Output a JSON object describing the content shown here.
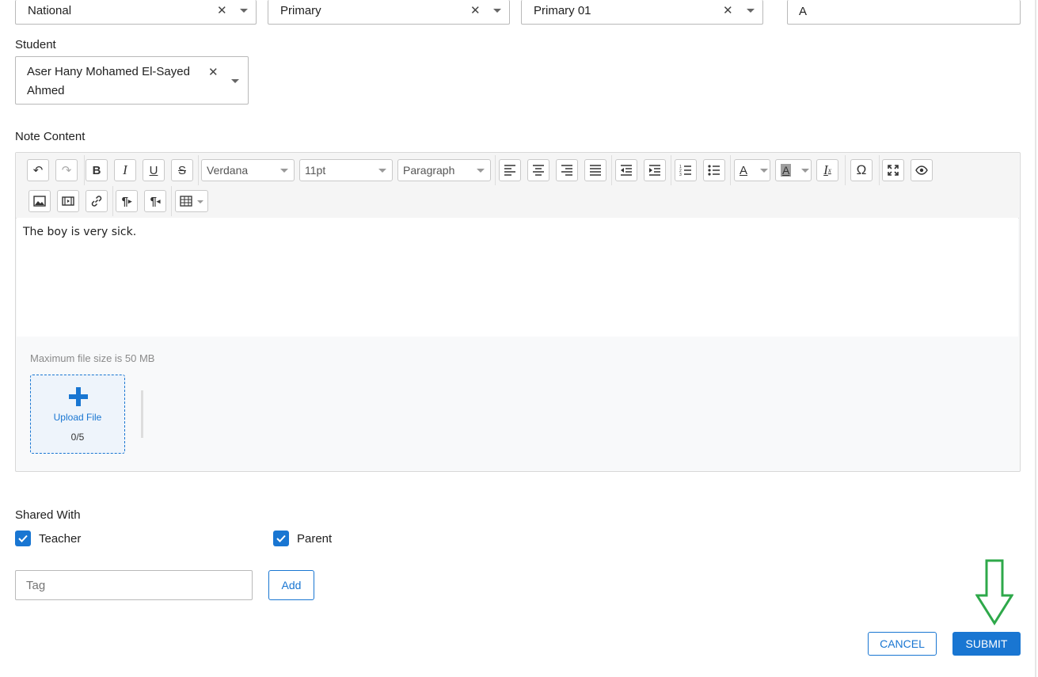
{
  "filters": [
    {
      "value": "National"
    },
    {
      "value": "Primary"
    },
    {
      "value": "Primary 01"
    },
    {
      "value": "A"
    }
  ],
  "student": {
    "label": "Student",
    "line1": "Aser Hany Mohamed El-Sayed",
    "line2": "Ahmed"
  },
  "note": {
    "label": "Note Content",
    "toolbar": {
      "font_family": "Verdana",
      "font_size": "11pt",
      "block_format": "Paragraph"
    },
    "content": "The boy is very sick.",
    "upload": {
      "max_size_text": "Maximum file size is 50 MB",
      "button_label": "Upload File",
      "count": "0/5"
    }
  },
  "shared_with": {
    "label": "Shared With",
    "options": [
      {
        "label": "Teacher",
        "checked": true
      },
      {
        "label": "Parent",
        "checked": true
      }
    ]
  },
  "tag": {
    "placeholder": "Tag",
    "add_label": "Add"
  },
  "actions": {
    "cancel_label": "CANCEL",
    "submit_label": "SUBMIT"
  },
  "colors": {
    "primary": "#1976d2",
    "annotation_arrow": "#2ea84a"
  },
  "icons": [
    "undo-icon",
    "redo-icon",
    "bold-icon",
    "italic-icon",
    "underline-icon",
    "strikethrough-icon",
    "align-left-icon",
    "align-center-icon",
    "align-right-icon",
    "align-justify-icon",
    "outdent-icon",
    "indent-icon",
    "numbered-list-icon",
    "bullet-list-icon",
    "text-color-icon",
    "highlight-color-icon",
    "clear-format-icon",
    "special-char-icon",
    "fullscreen-icon",
    "preview-icon",
    "image-icon",
    "video-icon",
    "link-icon",
    "ltr-icon",
    "rtl-icon",
    "table-icon",
    "plus-icon",
    "check-icon",
    "arrow-down-icon"
  ]
}
